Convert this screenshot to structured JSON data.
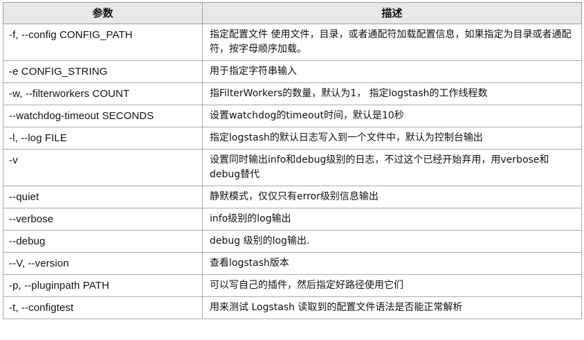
{
  "table": {
    "headers": {
      "param": "参数",
      "desc": "描述"
    },
    "rows": [
      {
        "param": "-f, --config CONFIG_PATH",
        "desc": "指定配置文件   使用文件，目录，或者通配符加载配置信息，如果指定为目录或者通配符，按字母顺序加载。"
      },
      {
        "param": "-e  CONFIG_STRING",
        "desc": "用于指定字符串输入"
      },
      {
        "param": "-w, --filterworkers COUNT",
        "desc": "指FilterWorkers的数量，默认为1，    指定logstash的工作线程数"
      },
      {
        "param": "--watchdog-timeout SECONDS",
        "desc": "设置watchdog的timeout时间，默认是10秒"
      },
      {
        "param": "-l, --log FILE",
        "desc": "指定logstash的默认日志写入到一个文件中，默认为控制台输出"
      },
      {
        "param": "-v",
        "desc": "设置同时输出info和debug级别的日志，不过这个已经开始弃用，用verbose和debug替代"
      },
      {
        "param": "--quiet",
        "desc": "静默模式，仅仅只有error级别信息输出"
      },
      {
        "param": "--verbose",
        "desc": "info级别的log输出"
      },
      {
        "param": "--debug",
        "desc": "debug 级别的log输出."
      },
      {
        "param": "--V, --version",
        "desc": "查看logstash版本"
      },
      {
        "param": "-p, --pluginpath PATH",
        "desc": "可以写自己的插件，然后指定好路径使用它们"
      },
      {
        "param": "-t, --configtest",
        "desc": "用来测试 Logstash 读取到的配置文件语法是否能正常解析"
      }
    ]
  }
}
